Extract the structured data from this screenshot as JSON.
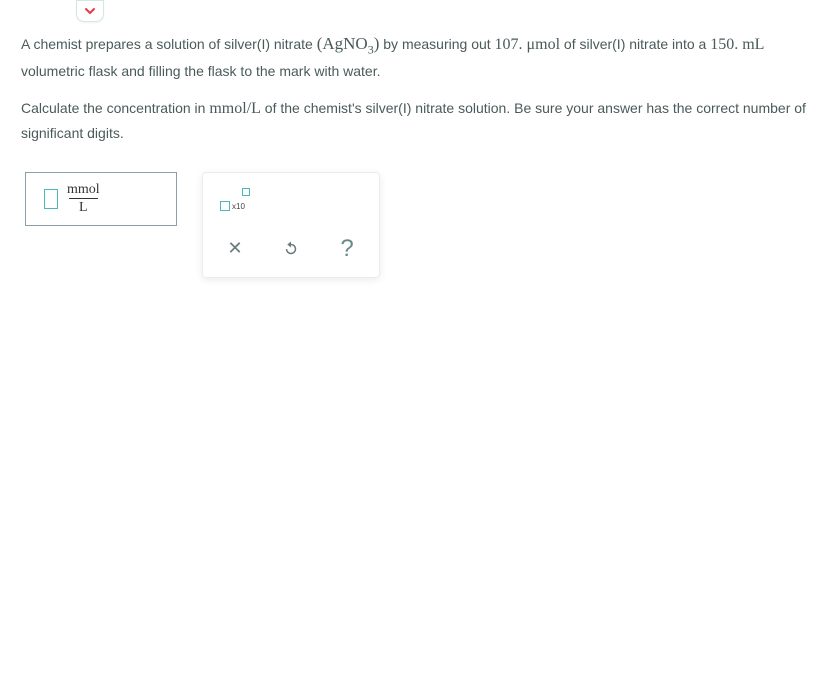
{
  "question": {
    "p1_part1": "A chemist prepares a solution of silver(I) nitrate ",
    "formula_open": "(",
    "formula_compound": "AgNO",
    "formula_sub": "3",
    "formula_close": ")",
    "p1_part2": " by measuring out ",
    "value1": "107. μmol",
    "p1_part3": " of silver(I) nitrate into a ",
    "value2": "150. mL",
    "p1_part4": " volumetric flask and filling the flask to the mark with water.",
    "p2_part1": "Calculate the concentration in ",
    "unit": "mmol/L",
    "p2_part2": " of the chemist's silver(I) nitrate solution. Be sure your answer has the correct number of significant digits."
  },
  "answer": {
    "numerator": "mmol",
    "denominator": "L"
  },
  "toolbox": {
    "sci_label": "x10",
    "clear_label": "✕",
    "help_label": "?"
  }
}
